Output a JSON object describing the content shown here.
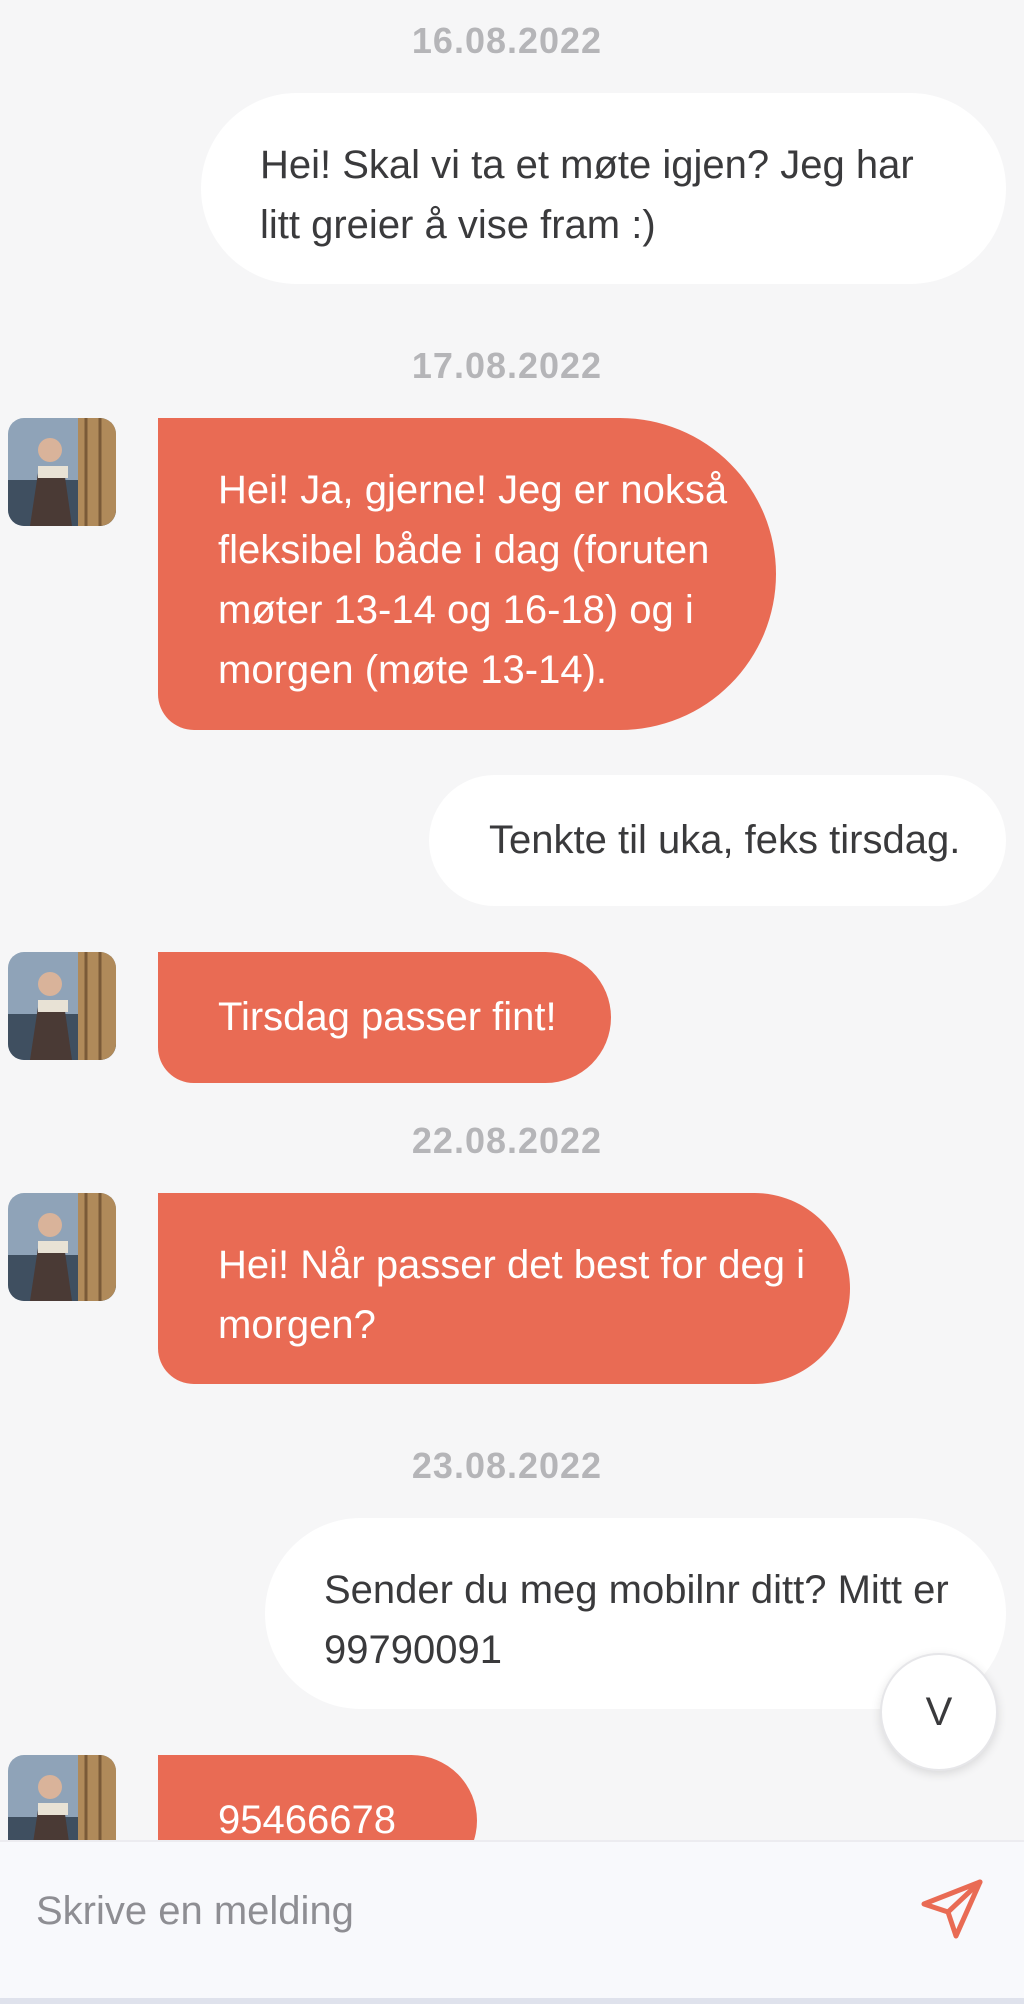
{
  "messages": [
    {
      "type": "date",
      "text": "16.08.2022"
    },
    {
      "type": "out",
      "text": "Hei! Skal vi ta et møte igjen? Jeg har litt greier å vise fram :)"
    },
    {
      "type": "date",
      "text": "17.08.2022"
    },
    {
      "type": "in",
      "text": "Hei! Ja, gjerne! Jeg er nokså fleksibel både i dag (foruten møter 13-14 og 16-18) og i morgen (møte 13-14)."
    },
    {
      "type": "out",
      "text": "Tenkte til uka, feks tirsdag."
    },
    {
      "type": "in",
      "text": "Tirsdag passer fint!"
    },
    {
      "type": "date",
      "text": "22.08.2022"
    },
    {
      "type": "in",
      "text": "Hei! Når passer det best for deg i morgen?"
    },
    {
      "type": "date",
      "text": "23.08.2022"
    },
    {
      "type": "out",
      "text": "Sender du meg mobilnr ditt? Mitt er 99790091"
    },
    {
      "type": "in",
      "text": "95466678"
    }
  ],
  "scroll_button": {
    "label": "V"
  },
  "composer": {
    "placeholder": "Skrive en melding"
  },
  "colors": {
    "accent": "#e96b54",
    "background": "#f6f6f7",
    "outgoing_bubble": "#ffffff",
    "text": "#3a3a3c",
    "date_text": "#b5b5b8"
  },
  "icons": {
    "avatar": "avatar",
    "send": "send-icon"
  }
}
